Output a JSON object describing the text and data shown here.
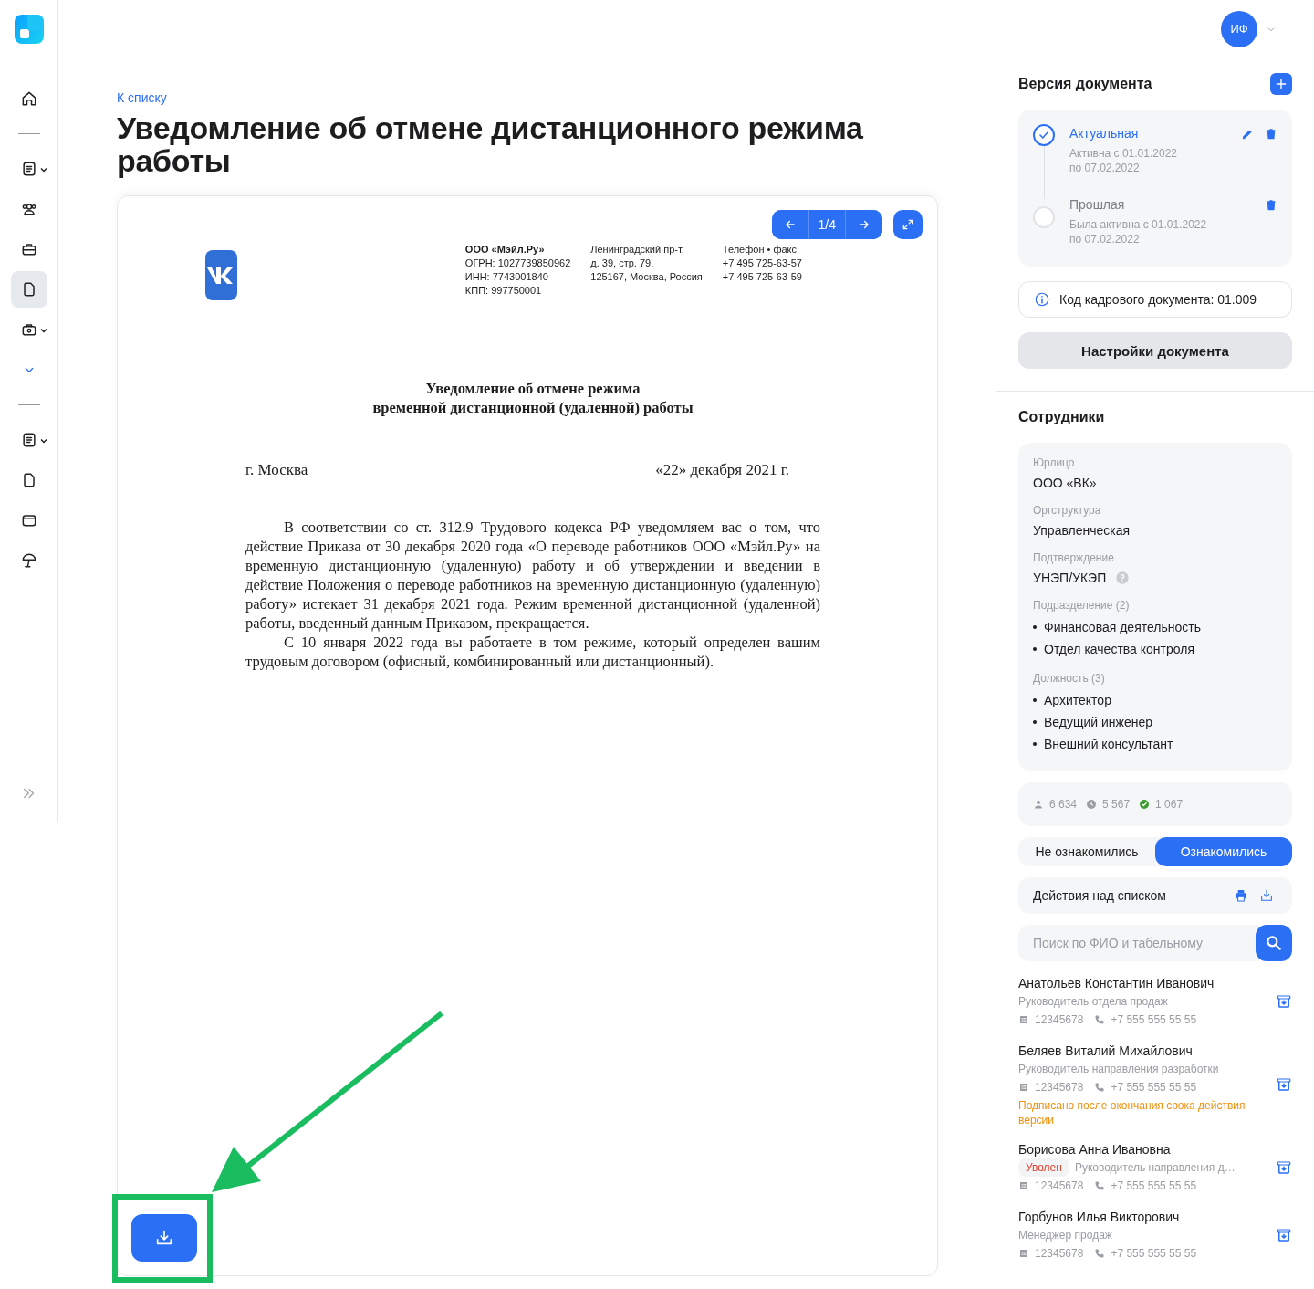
{
  "sidebar": {
    "items": [
      {
        "kind": "icon",
        "selected": false,
        "caret": false
      },
      {
        "kind": "divider"
      },
      {
        "kind": "icon",
        "selected": false,
        "caret": true
      },
      {
        "kind": "icon",
        "selected": false,
        "caret": false
      },
      {
        "kind": "icon",
        "selected": false,
        "caret": false
      },
      {
        "kind": "icon",
        "selected": true,
        "caret": false
      },
      {
        "kind": "icon",
        "selected": false,
        "caret": true
      },
      {
        "kind": "more"
      },
      {
        "kind": "divider"
      },
      {
        "kind": "icon",
        "selected": false,
        "caret": true
      },
      {
        "kind": "icon",
        "selected": false,
        "caret": false
      },
      {
        "kind": "icon",
        "selected": false,
        "caret": false
      },
      {
        "kind": "icon",
        "selected": false,
        "caret": false
      }
    ]
  },
  "header": {
    "avatar": "ИФ"
  },
  "breadcrumb": "К списку",
  "title": "Уведомление об отмене дистанционного режима работы",
  "viewer": {
    "page": "1/4",
    "document": {
      "company": [
        "ООО «Мэйл.Ру»",
        "ОГРН: 1027739850962",
        "ИНН: 7743001840",
        "КПП: 997750001"
      ],
      "address": [
        "Ленинградский пр-т,",
        "д. 39, стр. 79,",
        "125167, Москва, Россия"
      ],
      "contacts": [
        "Телефон • факс:",
        "+7 495 725-63-57",
        "+7 495 725-63-59"
      ],
      "heading": [
        "Уведомление об отмене режима",
        "временной дистанционной (удаленной) работы"
      ],
      "city": "г. Москва",
      "date": "«22» декабря 2021 г.",
      "paragraphs": [
        "В соответствии со ст. 312.9 Трудового кодекса РФ уведомляем вас о том, что действие Приказа от 30 декабря 2020 года «О переводе работников ООО «Мэйл.Ру» на временную дистанционную (удаленную) работу и об утверждении и введении в действие Положения о переводе работников на временную дистанционную (удаленную) работу» истекает 31 декабря 2021 года. Режим временной дистанционной (удаленной) работы, введенный данным Приказом, прекращается.",
        "С 10 января 2022 года вы работаете в том режиме, который определен вашим трудовым договором (офисный, комбинированный или дистанционный)."
      ]
    }
  },
  "versions": {
    "title": "Версия документа",
    "items": [
      {
        "name": "Актуальная",
        "selected": true,
        "editable": true,
        "lines": [
          "Активна с 01.01.2022",
          "по 07.02.2022"
        ]
      },
      {
        "name": "Прошлая",
        "selected": false,
        "editable": false,
        "lines": [
          "Была активна с 01.01.2022",
          "по 07.02.2022"
        ]
      }
    ],
    "code": "Код кадрового документа: 01.009",
    "settings_button": "Настройки документа"
  },
  "employees": {
    "title": "Сотрудники",
    "details": [
      {
        "kind": "text",
        "label": "Юрлицо",
        "value": "ООО «ВК»"
      },
      {
        "kind": "text",
        "label": "Оргструктура",
        "value": "Управленческая"
      },
      {
        "kind": "help",
        "label": "Подтверждение",
        "value": "УНЭП/УКЭП"
      },
      {
        "kind": "list",
        "label": "Подразделение (2)",
        "items": [
          "Финансовая деятельность",
          "Отдел качества контроля"
        ]
      },
      {
        "kind": "list",
        "label": "Должность (3)",
        "items": [
          "Архитектор",
          "Ведущий инженер",
          "Внешний консультант"
        ]
      }
    ],
    "stats": [
      {
        "kind": "person",
        "value": "6 634"
      },
      {
        "kind": "clock",
        "value": "5 567"
      },
      {
        "kind": "check",
        "value": "1 067"
      }
    ],
    "filters": [
      {
        "label": "Не ознакомились",
        "selected": false
      },
      {
        "label": "Ознакомились",
        "selected": true
      }
    ],
    "actions": "Действия над списком",
    "search": {
      "placeholder": "Поиск по ФИО и табельному"
    },
    "people": [
      {
        "name": "Анатольев Константин Иванович",
        "position": "Руководитель отдела продаж",
        "number": "12345678",
        "phone": "+7 555 555 55 55"
      },
      {
        "name": "Беляев Виталий Михайлович",
        "position": "Руководитель направления разработки",
        "number": "12345678",
        "phone": "+7 555 555 55 55",
        "note": "Подписано после окончания срока действия версии"
      },
      {
        "name": "Борисова Анна Ивановна",
        "tag": "Уволен",
        "position": "Руководитель направления д…",
        "number": "12345678",
        "phone": "+7 555 555 55 55"
      },
      {
        "name": "Горбунов Илья Викторович",
        "position": "Менеджер продаж",
        "number": "12345678",
        "phone": "+7 555 555 55 55"
      }
    ]
  }
}
